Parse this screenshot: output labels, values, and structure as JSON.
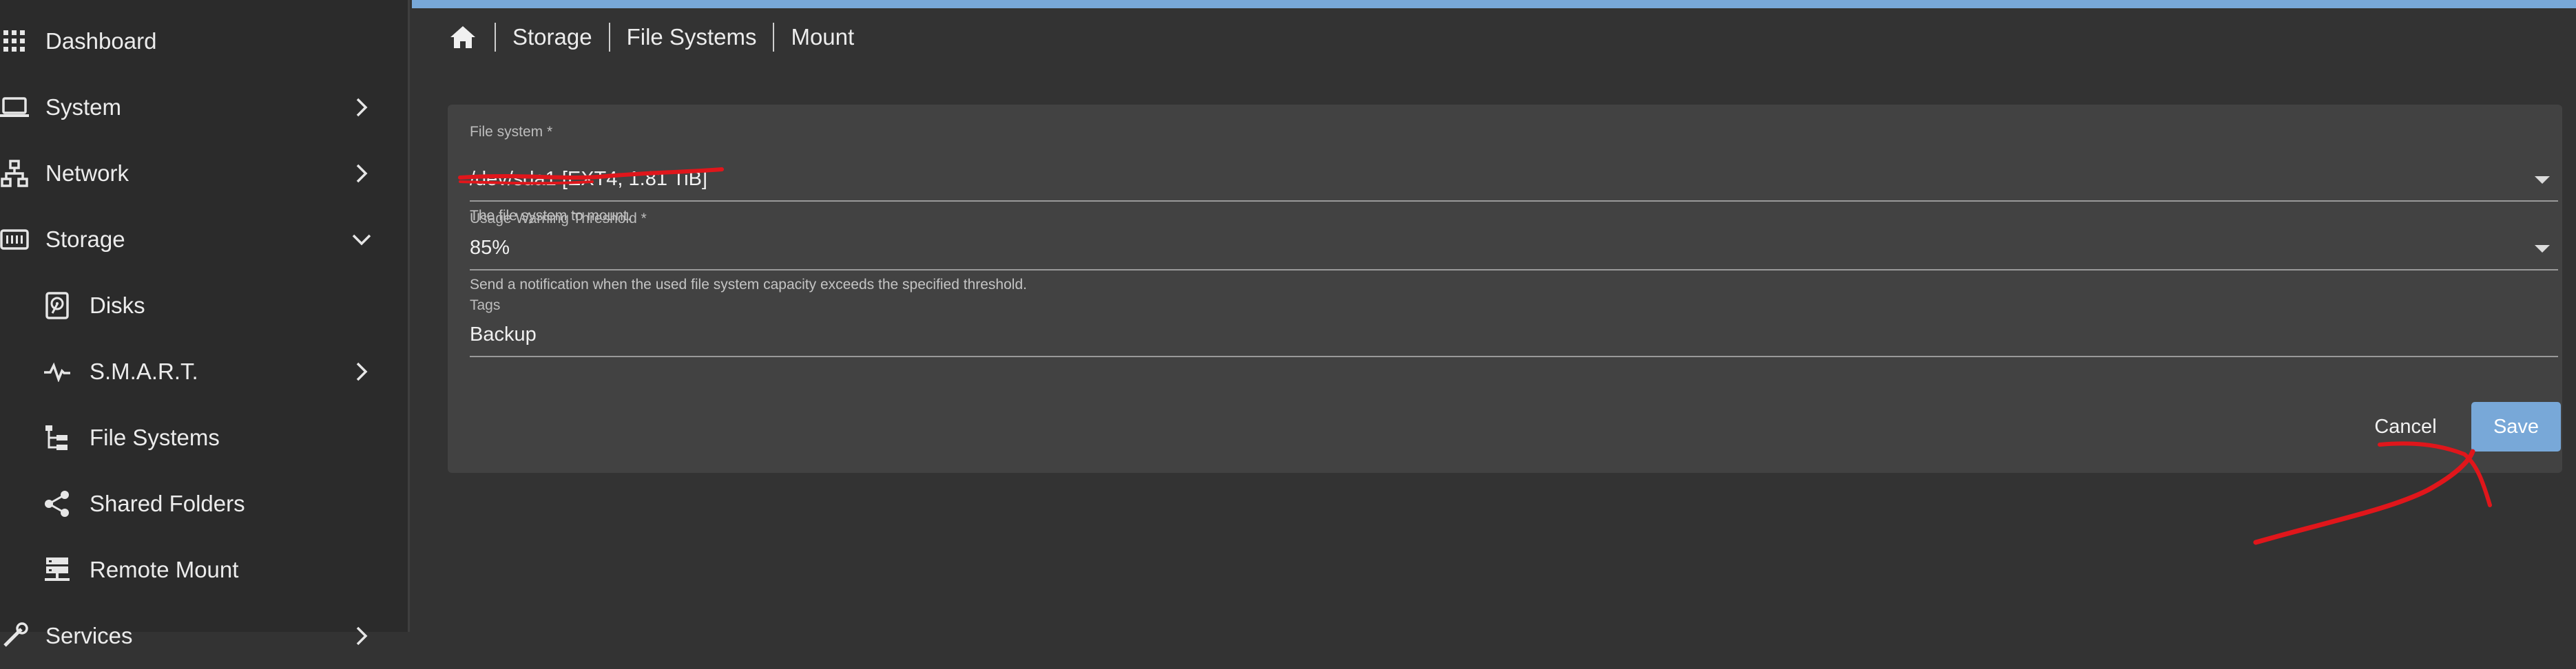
{
  "sidebar": {
    "items": [
      {
        "label": "Dashboard",
        "icon": "grid-icon"
      },
      {
        "label": "System",
        "icon": "laptop-icon"
      },
      {
        "label": "Network",
        "icon": "network-icon"
      },
      {
        "label": "Storage",
        "icon": "storage-icon"
      },
      {
        "label": "Disks",
        "icon": "disk-icon"
      },
      {
        "label": "S.M.A.R.T.",
        "icon": "pulse-icon"
      },
      {
        "label": "File Systems",
        "icon": "file-tree-icon"
      },
      {
        "label": "Shared Folders",
        "icon": "share-icon"
      },
      {
        "label": "Remote Mount",
        "icon": "server-icon"
      },
      {
        "label": "Services",
        "icon": "services-icon"
      }
    ]
  },
  "breadcrumb": {
    "items": [
      "Storage",
      "File Systems",
      "Mount"
    ]
  },
  "form": {
    "file_system": {
      "label": "File system *",
      "value": "/dev/sda1 [EXT4, 1.81 TiB]",
      "hint": "The file system to mount."
    },
    "usage_threshold": {
      "label": "Usage Warning Threshold *",
      "value": "85%",
      "hint": "Send a notification when the used file system capacity exceeds the specified threshold."
    },
    "tags": {
      "label": "Tags",
      "value": "Backup"
    },
    "cancel_label": "Cancel",
    "save_label": "Save"
  },
  "colors": {
    "accent": "#78a8d8",
    "annotation": "#e0161b",
    "sidebar_bg": "#2b2b2b",
    "content_bg": "#333333",
    "card_bg": "#424242"
  }
}
